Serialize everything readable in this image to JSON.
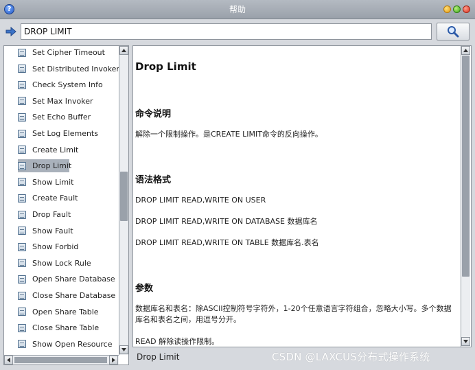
{
  "window": {
    "title": "帮助"
  },
  "search": {
    "value": "DROP LIMIT"
  },
  "sidebar": {
    "items": [
      {
        "label": "Set Cipher Timeout"
      },
      {
        "label": "Set Distributed Invoker Ti"
      },
      {
        "label": "Check System Info"
      },
      {
        "label": "Set Max Invoker"
      },
      {
        "label": "Set Echo Buffer"
      },
      {
        "label": "Set Log Elements"
      },
      {
        "label": "Create Limit"
      },
      {
        "label": "Drop Limit"
      },
      {
        "label": "Show Limit"
      },
      {
        "label": "Create Fault"
      },
      {
        "label": "Drop Fault"
      },
      {
        "label": "Show Fault"
      },
      {
        "label": "Show Forbid"
      },
      {
        "label": "Show Lock Rule"
      },
      {
        "label": "Open Share Database"
      },
      {
        "label": "Close Share Database"
      },
      {
        "label": "Open Share Table"
      },
      {
        "label": "Close Share Table"
      },
      {
        "label": "Show Open Resource"
      }
    ],
    "selected": "Drop Limit"
  },
  "doc": {
    "title": "Drop Limit",
    "section_desc": "命令说明",
    "desc": "解除一个限制操作。是CREATE LIMIT命令的反向操作。",
    "section_syntax": "语法格式",
    "syntax_1": "DROP LIMIT READ,WRITE ON USER",
    "syntax_2": "DROP LIMIT READ,WRITE ON DATABASE 数据库名",
    "syntax_3": "DROP LIMIT READ,WRITE ON TABLE 数据库名.表名",
    "section_params": "参数",
    "params": "数据库名和表名：除ASCII控制符号字符外，1-20个任意语言字符组合，忽略大小写。多个数据库名和表名之间，用逗号分开。",
    "param_read": "READ 解除读操作限制。"
  },
  "status": {
    "text": "Drop Limit"
  },
  "watermark": {
    "text": "CSDN @LAXCUS分布式操作系统"
  },
  "colors": {
    "selection": "#a9b1bb",
    "titlebar": "#9aa1aa",
    "background": "#d6d9de"
  }
}
